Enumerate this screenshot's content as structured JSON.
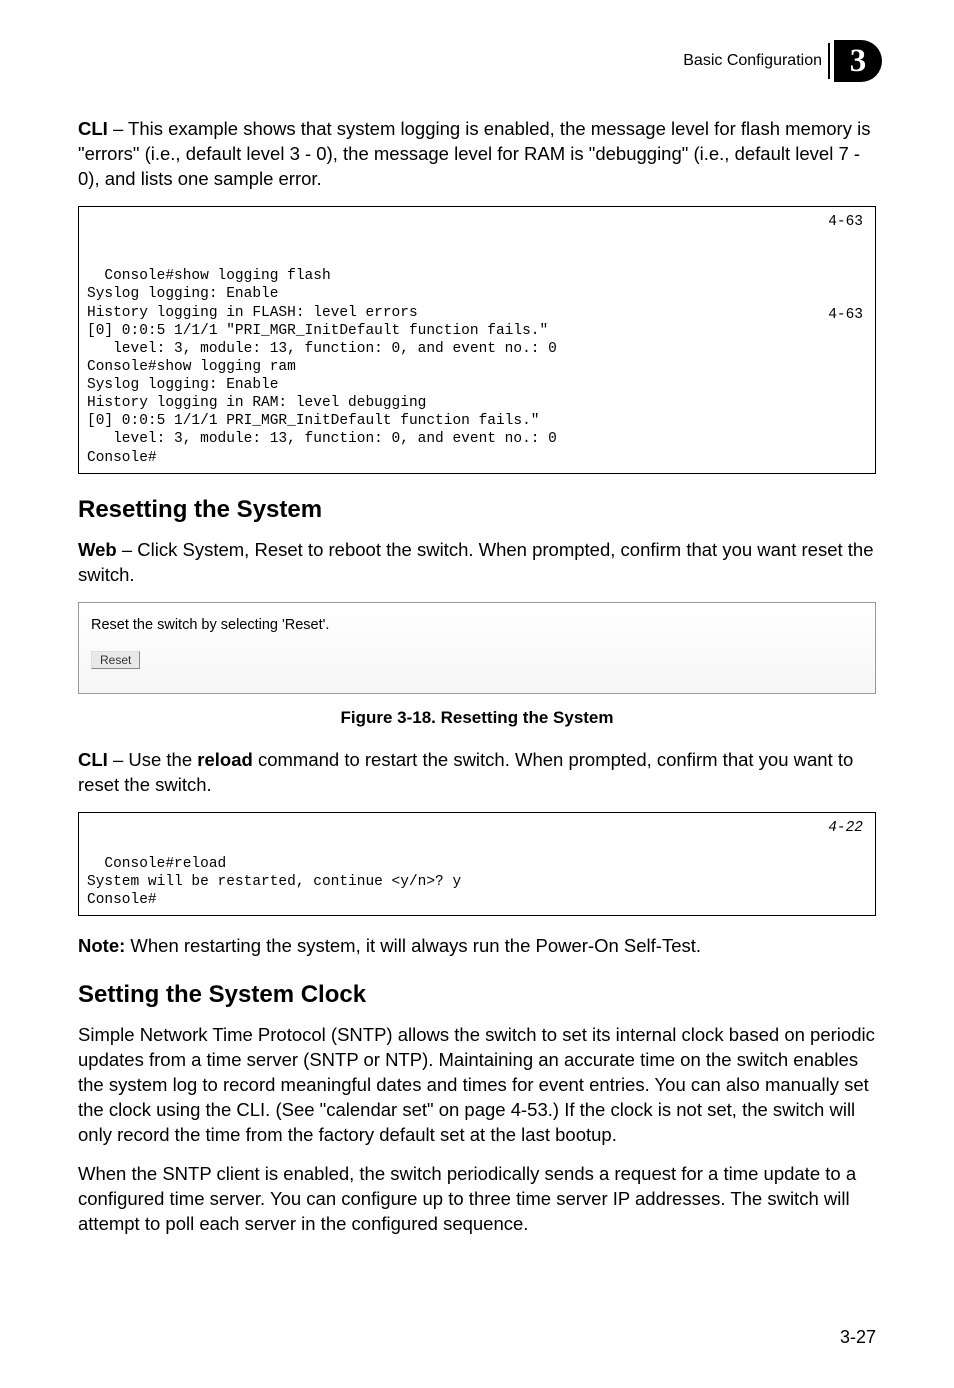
{
  "header": {
    "title": "Basic Configuration",
    "chapter_badge": "3"
  },
  "intro_cli": {
    "label": "CLI",
    "text": " – This example shows that system logging is enabled, the message level for flash memory is \"errors\" (i.e., default level 3 - 0), the message level for RAM is \"debugging\" (i.e., default level 7 - 0), and lists one sample error."
  },
  "codebox1": {
    "ref1": "4-63",
    "ref2": "4-63",
    "content": "Console#show logging flash\nSyslog logging: Enable\nHistory logging in FLASH: level errors\n[0] 0:0:5 1/1/1 \"PRI_MGR_InitDefault function fails.\"\n   level: 3, module: 13, function: 0, and event no.: 0\nConsole#show logging ram\nSyslog logging: Enable\nHistory logging in RAM: level debugging\n[0] 0:0:5 1/1/1 PRI_MGR_InitDefault function fails.\"\n   level: 3, module: 13, function: 0, and event no.: 0\nConsole#"
  },
  "reset_section": {
    "heading": "Resetting the System",
    "web_label": "Web",
    "web_text": " – Click System, Reset to reboot the switch. When prompted, confirm that you want reset the switch.",
    "panel_text": "Reset the switch by selecting 'Reset'.",
    "button_label": "Reset",
    "figure_caption": "Figure 3-18.  Resetting the System",
    "cli_label": "CLI",
    "cli_text_pre": " – Use the ",
    "cli_command": "reload",
    "cli_text_post": " command to restart the switch. When prompted, confirm that you want to reset the switch."
  },
  "codebox2": {
    "ref": "4-22",
    "content": "Console#reload\nSystem will be restarted, continue <y/n>? y\nConsole#"
  },
  "note": {
    "label": "Note:",
    "text": "  When restarting the system, it will always run the Power-On Self-Test."
  },
  "clock_section": {
    "heading": "Setting the System Clock",
    "para1": "Simple Network Time Protocol (SNTP) allows the switch to set its internal clock based on periodic updates from a time server (SNTP or NTP). Maintaining an accurate time on the switch enables the system log to record meaningful dates and times for event entries. You can also manually set the clock using the CLI. (See \"calendar set\" on page 4-53.) If the clock is not set, the switch will only record the time from the factory default set at the last bootup.",
    "para2": "When the SNTP client is enabled, the switch periodically sends a request for a time update to a configured time server. You can configure up to three time server IP addresses. The switch will attempt to poll each server in the configured sequence."
  },
  "page_number": "3-27"
}
